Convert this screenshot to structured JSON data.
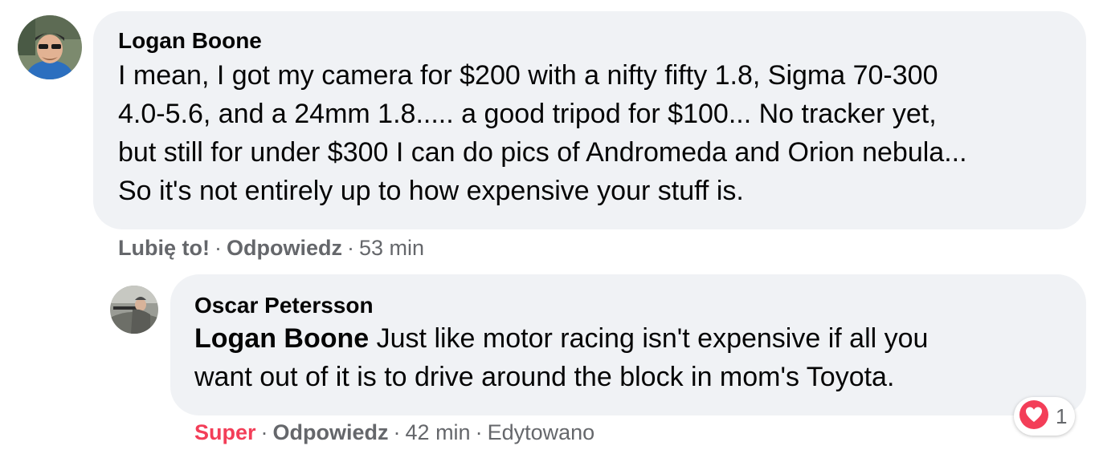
{
  "comments": [
    {
      "author": "Logan Boone",
      "text_lines": [
        "I mean, I got my camera for $200 with a nifty fifty 1.8, Sigma 70-300",
        "4.0-5.6, and a 24mm 1.8..... a good tripod for $100... No tracker yet,",
        "but still for under $300 I can do pics of Andromeda and Orion nebula...",
        "So it's not entirely up to how expensive your stuff is."
      ],
      "actions": {
        "like": "Lubię to!",
        "reply": "Odpowiedz",
        "time": "53 min"
      }
    },
    {
      "author": "Oscar Petersson",
      "mention": "Logan Boone",
      "text_first_rest": " Just like motor racing isn't expensive if all you",
      "text_second": "want out of it is to drive around the block in mom's Toyota.",
      "actions": {
        "like": "Super",
        "reply": "Odpowiedz",
        "time": "42 min",
        "edited": "Edytowano"
      },
      "reaction": {
        "icon": "heart-icon",
        "count": "1",
        "color": "#f33e58"
      }
    }
  ],
  "separator": "·"
}
